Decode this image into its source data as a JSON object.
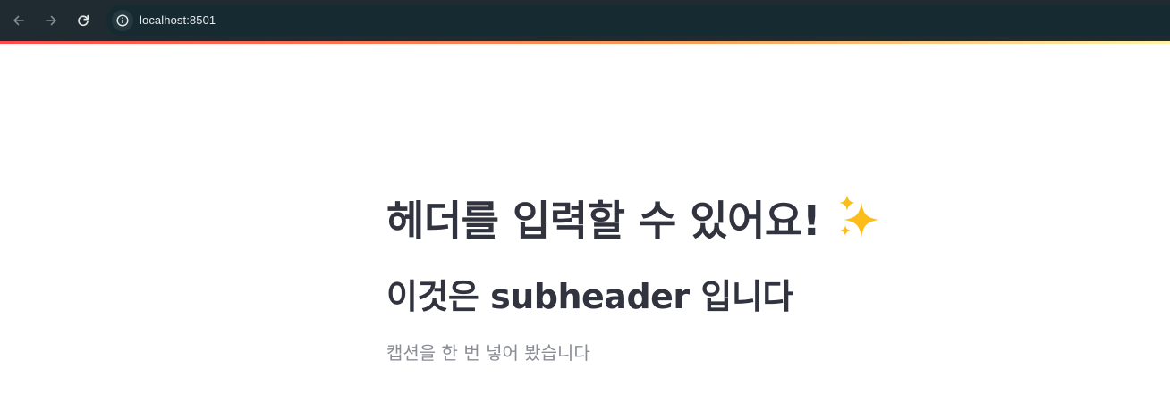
{
  "browser": {
    "url": "localhost:8501",
    "back_icon": "arrow-left-icon",
    "forward_icon": "arrow-right-icon",
    "reload_icon": "reload-icon",
    "site_info_icon": "info-circle-icon"
  },
  "app": {
    "accent_colors": [
      "#ff4b4b",
      "#f7a15a",
      "#fff3a8"
    ],
    "header": "헤더를 입력할 수 있어요!",
    "header_emoji": "sparkles-icon",
    "subheader": "이것은 subheader 입니다",
    "caption": "캡션을 한 번 넣어 봤습니다"
  }
}
